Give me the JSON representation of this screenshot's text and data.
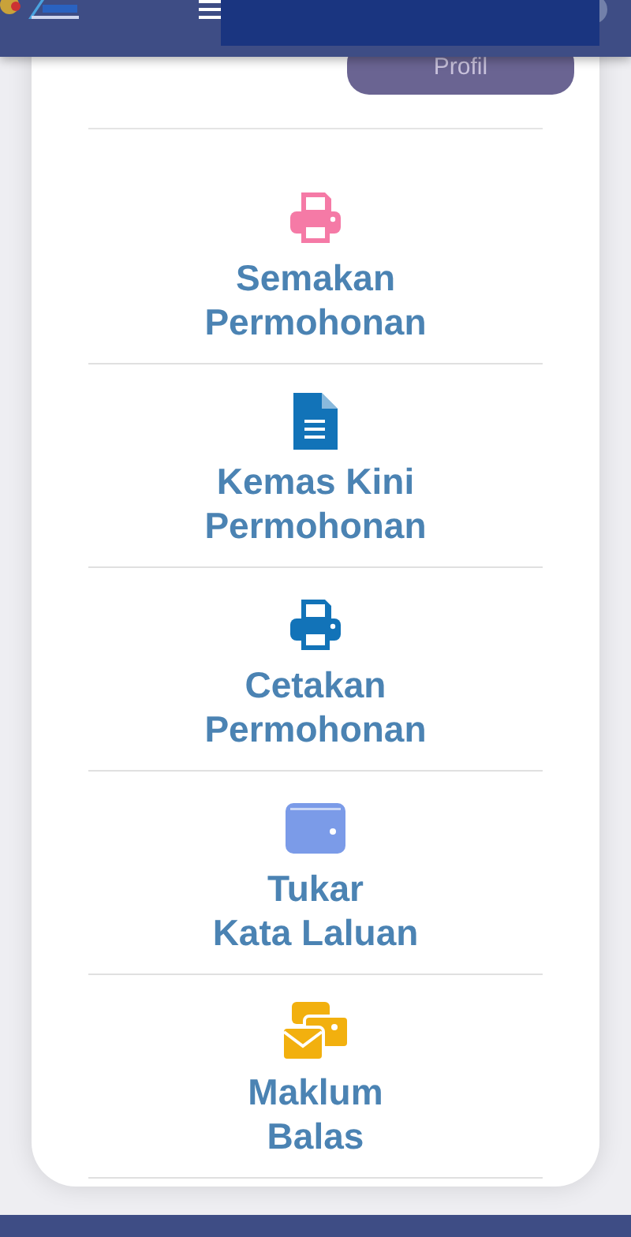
{
  "profile_button": {
    "label": "Profil"
  },
  "menu_items": [
    {
      "kind": "printer",
      "color": "#f57aa6",
      "label_lines": [
        "Semakan",
        "Permohonan"
      ]
    },
    {
      "kind": "document",
      "color": "#1273b8",
      "label_lines": [
        "Kemas Kini",
        "Permohonan"
      ]
    },
    {
      "kind": "printer",
      "color": "#1273b8",
      "label_lines": [
        "Cetakan",
        "Permohonan"
      ]
    },
    {
      "kind": "wallet",
      "color": "#7b9be8",
      "label_lines": [
        "Tukar",
        "Kata Laluan"
      ]
    },
    {
      "kind": "envelopes",
      "color": "#f2b00e",
      "label_lines": [
        "Maklum",
        "Balas"
      ]
    }
  ]
}
